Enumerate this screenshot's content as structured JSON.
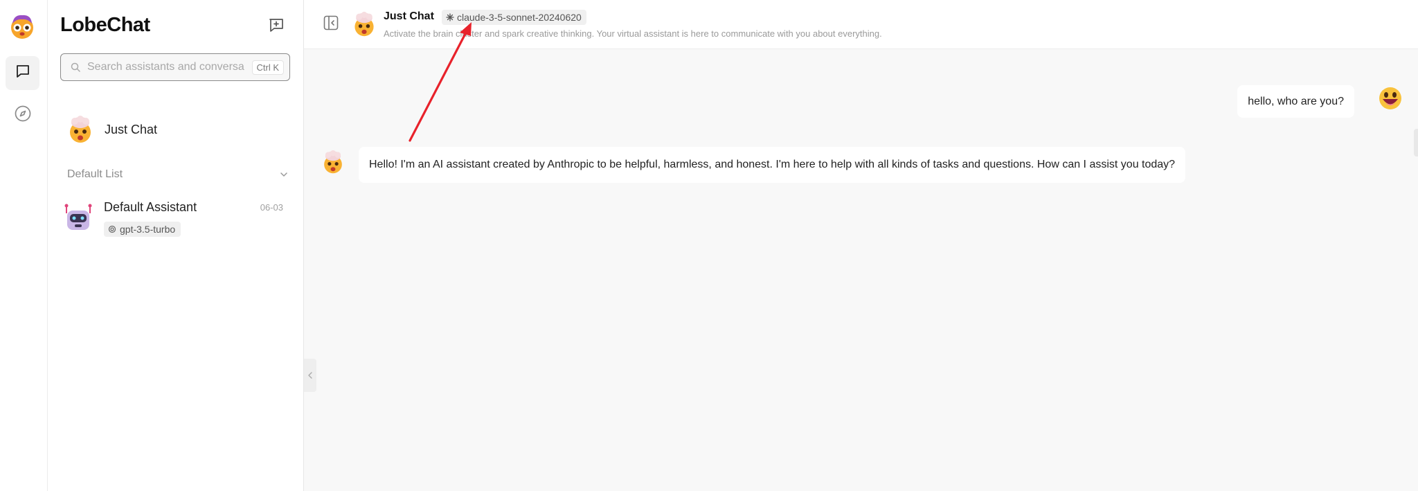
{
  "rail": {
    "items": [
      {
        "name": "chat",
        "icon": "chat-bubble-icon",
        "active": true
      },
      {
        "name": "discover",
        "icon": "compass-icon",
        "active": false
      }
    ]
  },
  "sidebar": {
    "logo": "LobeChat",
    "new_chat_icon": "message-plus-icon",
    "search": {
      "placeholder": "Search assistants and conversa",
      "shortcut": "Ctrl K"
    },
    "inbox": {
      "label": "Just Chat",
      "icon": "exploding-head-emoji"
    },
    "group": {
      "label": "Default List",
      "icon": "chevron-down-icon"
    },
    "assistants": [
      {
        "name": "Default Assistant",
        "date": "06-03",
        "model": "gpt-3.5-turbo",
        "avatar": "robot-emoji"
      }
    ]
  },
  "header": {
    "title": "Just Chat",
    "model": "claude-3-5-sonnet-20240620",
    "description": "Activate the brain cluster and spark creative thinking. Your virtual assistant is here to communicate with you about everything."
  },
  "messages": [
    {
      "role": "user",
      "text": "hello, who are you?"
    },
    {
      "role": "assistant",
      "text": "Hello! I'm an AI assistant created by Anthropic to be helpful, harmless, and honest. I'm here to help with all kinds of tasks and questions. How can I assist you today?"
    }
  ],
  "colors": {
    "accent": "#1f1f1f",
    "annotation_arrow": "#e8222b",
    "background_main": "#f8f8f8"
  }
}
